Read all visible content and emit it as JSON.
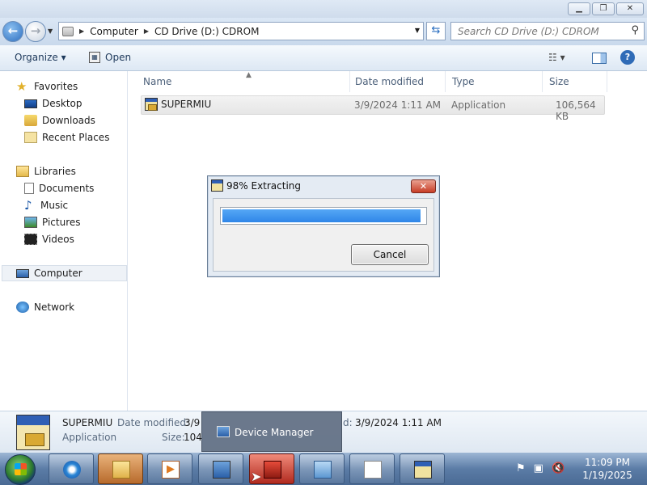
{
  "window": {
    "minimize_glyph": "▁",
    "restore_glyph": "❐",
    "close_glyph": "✕"
  },
  "address": {
    "crumbs": [
      "Computer",
      "CD Drive (D:) CDROM"
    ],
    "search_placeholder": "Search CD Drive (D:) CDROM"
  },
  "toolbar": {
    "organize_label": "Organize ▾",
    "open_label": "Open",
    "views_glyph": "☷ ▾",
    "help_glyph": "?"
  },
  "sidebar": {
    "favorites": "Favorites",
    "desktop": "Desktop",
    "downloads": "Downloads",
    "recent_places": "Recent Places",
    "libraries": "Libraries",
    "documents": "Documents",
    "music": "Music",
    "pictures": "Pictures",
    "videos": "Videos",
    "computer": "Computer",
    "network": "Network"
  },
  "columns": {
    "name": "Name",
    "date_modified": "Date modified",
    "type": "Type",
    "size": "Size"
  },
  "files": [
    {
      "name": "SUPERMIU",
      "date_modified": "3/9/2024 1:11 AM",
      "type": "Application",
      "size": "106,564 KB"
    }
  ],
  "dialog": {
    "title": "98% Extracting",
    "progress_fraction": 0.98,
    "cancel_label": "Cancel",
    "close_glyph": "✕"
  },
  "details": {
    "name": "SUPERMIU",
    "date_label": "Date modified:",
    "date_value_truncated": "3/9",
    "date_value": "3/9/2024 1:11 AM",
    "date_suffix_fragment": "d:",
    "type": "Application",
    "size_label": "Size:",
    "size_value_truncated": "104"
  },
  "tooltip": {
    "text": "Device Manager"
  },
  "taskbar": {
    "tray_icons": [
      "flag-icon",
      "network-icon",
      "volume-muted-icon"
    ],
    "tray_glyphs": [
      "⚑",
      "▣",
      "🔇"
    ],
    "time": "11:09 PM",
    "date": "1/19/2025"
  }
}
